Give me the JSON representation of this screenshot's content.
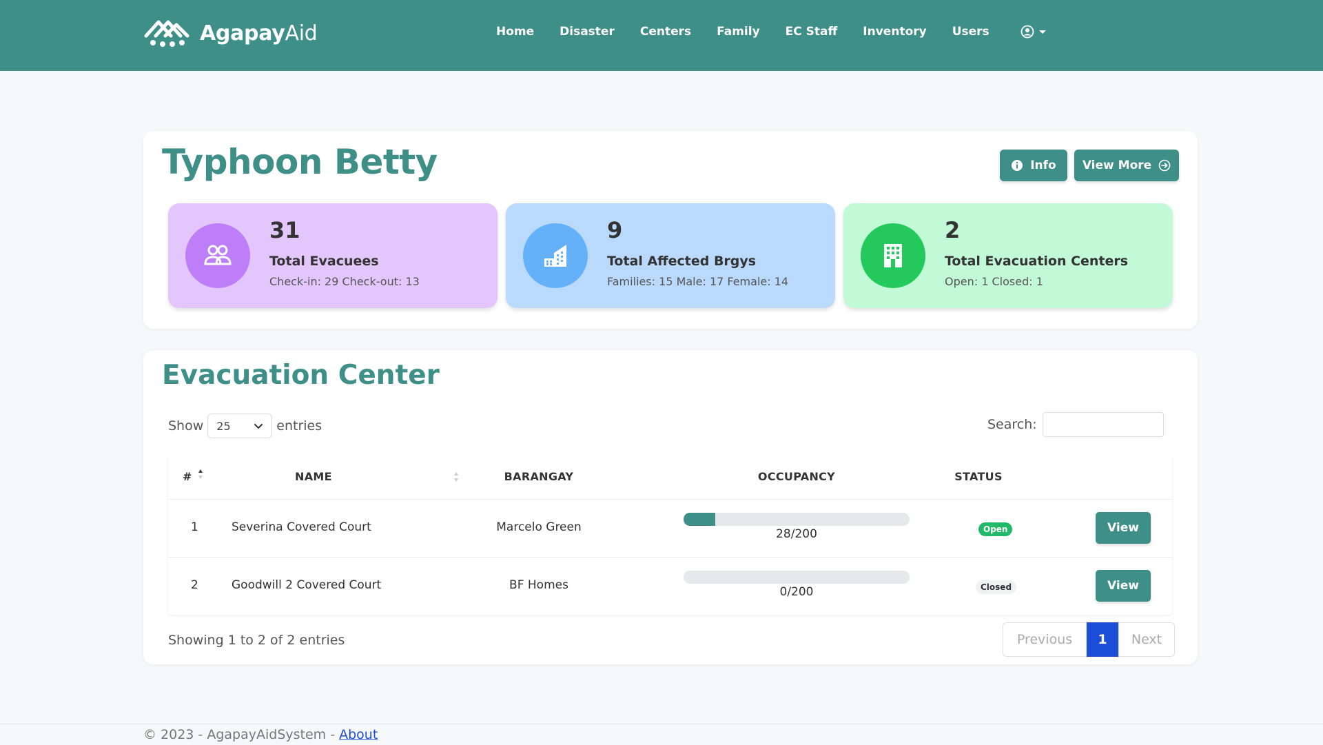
{
  "brand": {
    "name_bold": "Agapay",
    "name_light": "Aid"
  },
  "nav": {
    "items": [
      "Home",
      "Disaster",
      "Centers",
      "Family",
      "EC Staff",
      "Inventory",
      "Users"
    ]
  },
  "hero": {
    "title": "Typhoon Betty",
    "info_label": "Info",
    "view_more_label": "View More",
    "stats": [
      {
        "number": "31",
        "label": "Total Evacuees",
        "sub": "Check-in: 29 Check-out: 13",
        "icon": "users-icon",
        "color": "#e2c6fc"
      },
      {
        "number": "9",
        "label": "Total Affected Brgys",
        "sub": "Families: 15 Male: 17 Female: 14",
        "icon": "city-buildings-icon",
        "color": "#b9d9fd"
      },
      {
        "number": "2",
        "label": "Total Evacuation Centers",
        "sub": "Open: 1 Closed: 1",
        "icon": "building-icon",
        "color": "#c2f9d6"
      }
    ]
  },
  "centers": {
    "title": "Evacuation Center",
    "show_label": "Show",
    "entries_value": "25",
    "entries_label": "entries",
    "search_label": "Search:",
    "search_value": "",
    "columns": [
      "#",
      "NAME",
      "BARANGAY",
      "OCCUPANCY",
      "STATUS"
    ],
    "rows": [
      {
        "num": "1",
        "name": "Severina Covered Court",
        "barangay": "Marcelo Green",
        "occupancy": "28/200",
        "fill": 0.14,
        "status": "Open",
        "action": "View"
      },
      {
        "num": "2",
        "name": "Goodwill 2 Covered Court",
        "barangay": "BF Homes",
        "occupancy": "0/200",
        "fill": 0,
        "status": "Closed",
        "action": "View"
      }
    ],
    "showing_text": "Showing 1 to 2 of 2 entries",
    "pagination": {
      "previous": "Previous",
      "current": "1",
      "next": "Next"
    }
  },
  "footer": {
    "text": "© 2023 - AgapayAidSystem - ",
    "link": "About"
  },
  "colors": {
    "primary": "#3e8f87",
    "open_badge": "#22b968",
    "page_active": "#1d4ed8"
  }
}
